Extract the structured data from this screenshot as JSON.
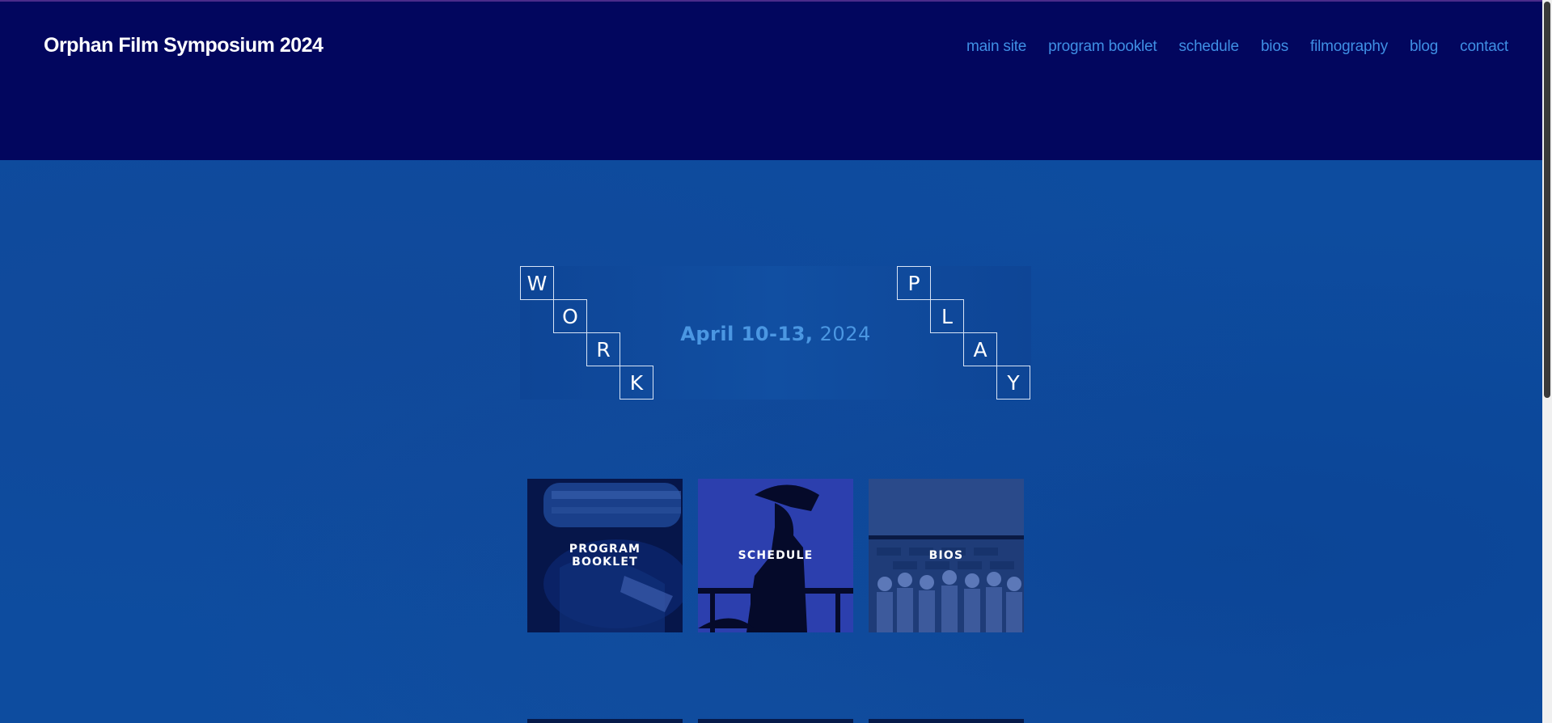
{
  "header": {
    "site_title": "Orphan Film Symposium 2024",
    "nav": [
      "main site",
      "program booklet",
      "schedule",
      "bios",
      "filmography",
      "blog",
      "contact"
    ]
  },
  "banner": {
    "work_letters": [
      "W",
      "O",
      "R",
      "K"
    ],
    "play_letters": [
      "P",
      "L",
      "A",
      "Y"
    ],
    "dates_bold": "April 10-13,",
    "dates_year": " 2024"
  },
  "cards": [
    {
      "label": "PROGRAM\nBOOKLET",
      "image": "film-reel-icon"
    },
    {
      "label": "SCHEDULE",
      "image": "bugler-silhouette-icon"
    },
    {
      "label": "BIOS",
      "image": "group-photo-icon"
    }
  ],
  "colors": {
    "header_bg": "#02065e",
    "nav_link": "#3f8fe4",
    "page_bg": "#0d4c9f"
  }
}
